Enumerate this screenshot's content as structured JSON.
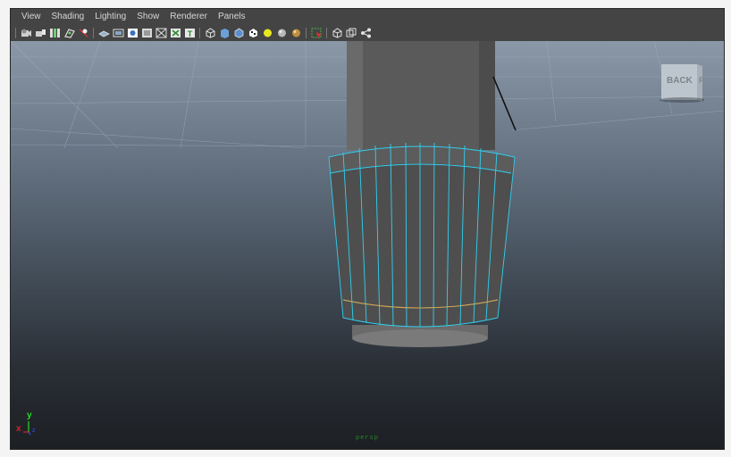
{
  "menubar": {
    "items": [
      "View",
      "Shading",
      "Lighting",
      "Show",
      "Renderer",
      "Panels"
    ]
  },
  "toolbar": {
    "icons": [
      "camera-icon",
      "camera-attributes-icon",
      "bookmarks-icon",
      "image-plane-icon",
      "two-d-pan-icon",
      "grid-icon",
      "film-gate-icon",
      "resolution-gate-icon",
      "gate-mask-icon",
      "field-chart-icon",
      "safe-action-icon",
      "safe-title-icon",
      "wireframe-icon",
      "smooth-shade-icon",
      "wireframe-on-shaded-icon",
      "textured-icon",
      "lights-icon",
      "shadows-icon",
      "isolate-icon",
      "select-camera-icon",
      "xray-icon",
      "backface-icon",
      "hierarchy-icon"
    ]
  },
  "viewcube": {
    "face_label": "BACK",
    "side_label": "F"
  },
  "viewport": {
    "camera_label": "persp"
  },
  "axis": {
    "x_label": "x",
    "y_label": "y",
    "z_label": "z"
  },
  "colors": {
    "wireframe": "#30d0f0",
    "edge_highlight": "#e0a040",
    "axis_x": "#e02020",
    "axis_y": "#20e020",
    "axis_z": "#3050ff"
  }
}
